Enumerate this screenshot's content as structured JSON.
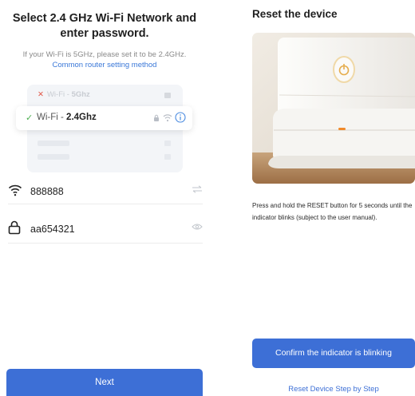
{
  "left": {
    "title": "Select 2.4 GHz Wi-Fi Network and enter password.",
    "subtitle": "If your Wi-Fi is 5GHz, please set it to be 2.4GHz.",
    "router_link": "Common router setting method",
    "networks": {
      "unsupported_prefix": "Wi-Fi - ",
      "unsupported_band": "5Ghz",
      "supported_prefix": "Wi-Fi - ",
      "supported_band": "2.4Ghz"
    },
    "wifi_field": {
      "value": "888888",
      "icon": "wifi-icon",
      "action_icon": "switch-arrows-icon"
    },
    "password_field": {
      "value": "aa654321",
      "icon": "lock-icon",
      "action_icon": "eye-icon"
    },
    "next_label": "Next"
  },
  "right": {
    "title": "Reset the device",
    "description": "Press and hold the RESET button for 5 seconds until the indicator blinks (subject to the user manual).",
    "confirm_label": "Confirm the indicator is blinking",
    "step_link": "Reset Device Step by Step"
  },
  "colors": {
    "accent": "#3d6fd6",
    "link": "#3a78d8",
    "ok": "#4caf50",
    "error": "#e25c4d"
  }
}
